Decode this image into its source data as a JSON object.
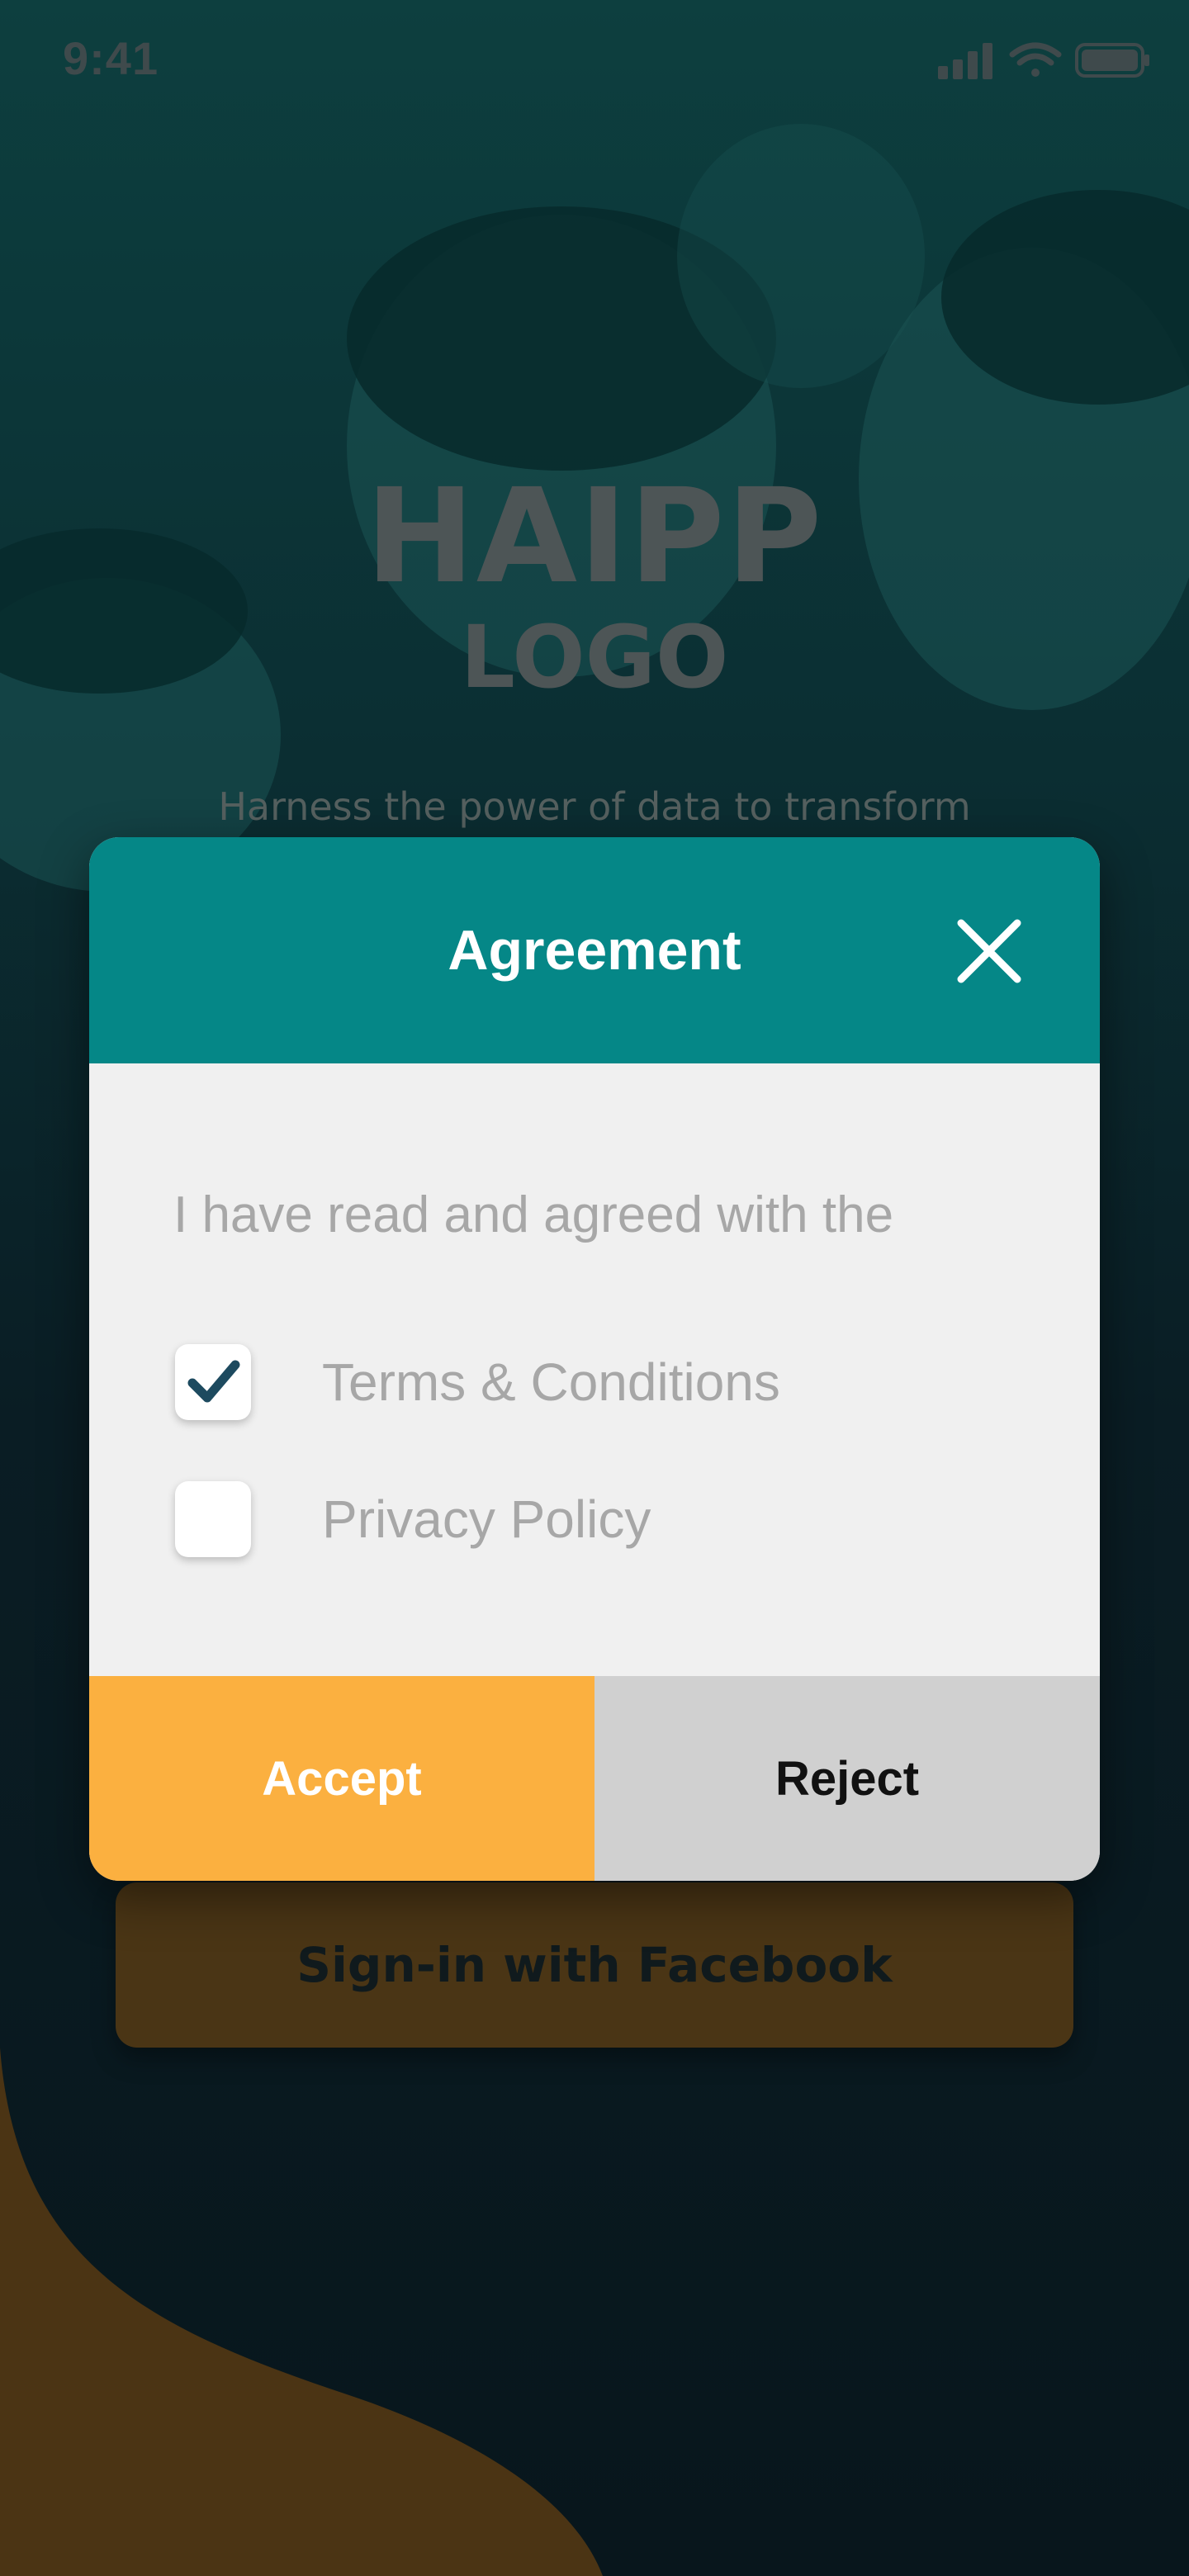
{
  "status_bar": {
    "time": "9:41",
    "icons": [
      "signal-icon",
      "wifi-icon",
      "battery-icon"
    ]
  },
  "background": {
    "logo_main": "HAIPP",
    "logo_sub": "LOGO",
    "tagline": "Harness the power of data to transform",
    "facebook_button_label": "Sign-in with Facebook"
  },
  "dialog": {
    "title": "Agreement",
    "close_icon": "close-icon",
    "intro": "I have read and agreed with the",
    "options": [
      {
        "label": "Terms & Conditions",
        "checked": true
      },
      {
        "label": "Privacy Policy",
        "checked": false
      }
    ],
    "accept_label": "Accept",
    "reject_label": "Reject"
  },
  "colors": {
    "header": "#058787",
    "accept": "#fbb040",
    "reject": "#d0d0d0",
    "check": "#1d4a5f"
  }
}
